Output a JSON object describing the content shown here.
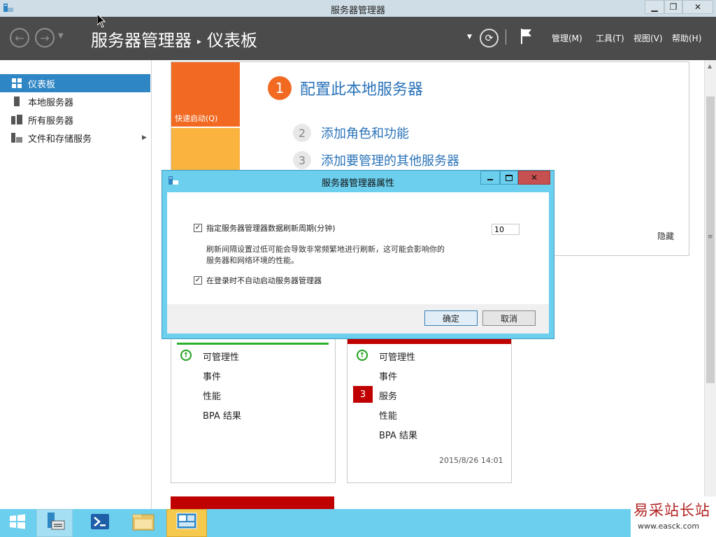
{
  "window": {
    "title": "服务器管理器",
    "minimize": "▁",
    "restore": "❐",
    "close": "✕"
  },
  "nav": {
    "breadcrumb_root": "服务器管理器",
    "breadcrumb_sep": "▸",
    "breadcrumb_page": "仪表板",
    "menus": [
      "管理(M)",
      "工具(T)",
      "视图(V)",
      "帮助(H)"
    ]
  },
  "sidebar": {
    "items": [
      {
        "label": "仪表板",
        "icon": "dashboard-icon"
      },
      {
        "label": "本地服务器",
        "icon": "server-icon"
      },
      {
        "label": "所有服务器",
        "icon": "servers-icon"
      },
      {
        "label": "文件和存储服务",
        "icon": "storage-icon",
        "arrow": "▶"
      }
    ]
  },
  "welcome": {
    "quick_start": "快速启动(Q)",
    "step1_num": "1",
    "step1": "配置此本地服务器",
    "step2_num": "2",
    "step2": "添加角色和功能",
    "step3_num": "3",
    "step3": "添加要管理的其他服务器",
    "hide": "隐藏"
  },
  "card1": {
    "rows": [
      "可管理性",
      "事件",
      "性能",
      "BPA 结果"
    ],
    "accent": "#2ab12a"
  },
  "card2": {
    "rows": [
      "可管理性",
      "事件",
      "服务",
      "性能",
      "BPA 结果"
    ],
    "badge": "3",
    "timestamp": "2015/8/26 14:01",
    "accent": "#c00000"
  },
  "dialog": {
    "title": "服务器管理器属性",
    "option1": "指定服务器管理器数据刷新周期(分钟)",
    "option1_value": "10",
    "option1_note_line1": "刷新间隔设置过低可能会导致非常频繁地进行刷新，这可能会影响你的",
    "option1_note_line2": "服务器和网络环境的性能。",
    "option2": "在登录时不自动启动服务器管理器",
    "ok": "确定",
    "cancel": "取消"
  },
  "watermark": {
    "title": "易采站长站",
    "url": "www.easck.com"
  }
}
